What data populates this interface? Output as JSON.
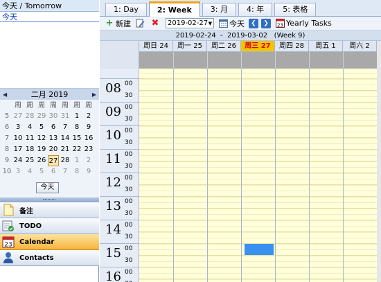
{
  "today_panel": {
    "header": "今天 / Tomorrow",
    "item": "今天"
  },
  "mini_calendar": {
    "month_label": "二月 2019",
    "weekday_headers": [
      "周",
      "周",
      "周",
      "周",
      "周",
      "周",
      "周"
    ],
    "weeks": [
      {
        "week": "5",
        "days": [
          [
            "27",
            "other"
          ],
          [
            "28",
            "other"
          ],
          [
            "29",
            "other"
          ],
          [
            "30",
            "other"
          ],
          [
            "31",
            "other"
          ],
          [
            "1",
            ""
          ],
          [
            "2",
            ""
          ]
        ]
      },
      {
        "week": "6",
        "days": [
          [
            "3",
            ""
          ],
          [
            "4",
            ""
          ],
          [
            "5",
            ""
          ],
          [
            "6",
            ""
          ],
          [
            "7",
            ""
          ],
          [
            "8",
            ""
          ],
          [
            "9",
            ""
          ]
        ]
      },
      {
        "week": "7",
        "days": [
          [
            "10",
            ""
          ],
          [
            "11",
            ""
          ],
          [
            "12",
            ""
          ],
          [
            "13",
            ""
          ],
          [
            "14",
            ""
          ],
          [
            "15",
            ""
          ],
          [
            "16",
            ""
          ]
        ]
      },
      {
        "week": "8",
        "days": [
          [
            "17",
            ""
          ],
          [
            "18",
            ""
          ],
          [
            "19",
            ""
          ],
          [
            "20",
            ""
          ],
          [
            "21",
            ""
          ],
          [
            "22",
            ""
          ],
          [
            "23",
            ""
          ]
        ]
      },
      {
        "week": "9",
        "days": [
          [
            "24",
            ""
          ],
          [
            "25",
            ""
          ],
          [
            "26",
            ""
          ],
          [
            "27",
            "today"
          ],
          [
            "28",
            ""
          ],
          [
            "1",
            "other"
          ],
          [
            "2",
            "other"
          ]
        ]
      },
      {
        "week": "10",
        "days": [
          [
            "3",
            "other"
          ],
          [
            "4",
            "other"
          ],
          [
            "5",
            "other"
          ],
          [
            "6",
            "other"
          ],
          [
            "7",
            "other"
          ],
          [
            "8",
            "other"
          ],
          [
            "9",
            "other"
          ]
        ]
      }
    ],
    "today_button": "今天"
  },
  "nav": [
    {
      "label": "备注",
      "icon": "note-icon",
      "active": false
    },
    {
      "label": "TODO",
      "icon": "todo-icon",
      "active": false
    },
    {
      "label": "Calendar",
      "icon": "calendar-icon",
      "icon_text": "23",
      "active": true
    },
    {
      "label": "Contacts",
      "icon": "contacts-icon",
      "active": false
    }
  ],
  "tabs": [
    {
      "label": "1: Day",
      "active": false
    },
    {
      "label": "2: Week",
      "active": true
    },
    {
      "label": "3: 月",
      "active": false
    },
    {
      "label": "4: 年",
      "active": false
    },
    {
      "label": "5: 表格",
      "active": false
    }
  ],
  "toolbar": {
    "new_label": "新建",
    "date_value": "2019-02-27",
    "today_label": "今天",
    "yearly_icon_text": "23",
    "yearly_label": "Yearly Tasks"
  },
  "range_label": "2019-02-24  -  2019-03-02   (Week 9)",
  "day_headers": [
    "周日 24",
    "周一 25",
    "周二 26",
    "周三 27",
    "周四 28",
    "周五 1",
    "周六 2"
  ],
  "today_index": 3,
  "hours": [
    "08",
    "09",
    "10",
    "11",
    "12",
    "13",
    "14",
    "15",
    "16"
  ],
  "minute_labels": [
    "00",
    "30"
  ],
  "selection": {
    "day_index": 3,
    "hour": "15",
    "minute": "00"
  },
  "colors": {
    "today_header_bg": "#f5c400",
    "today_header_text": "#dd0000",
    "slot_bg": "#ffffd9",
    "selection": "#3890f0",
    "active_tab_accent": "#f0a41c"
  }
}
